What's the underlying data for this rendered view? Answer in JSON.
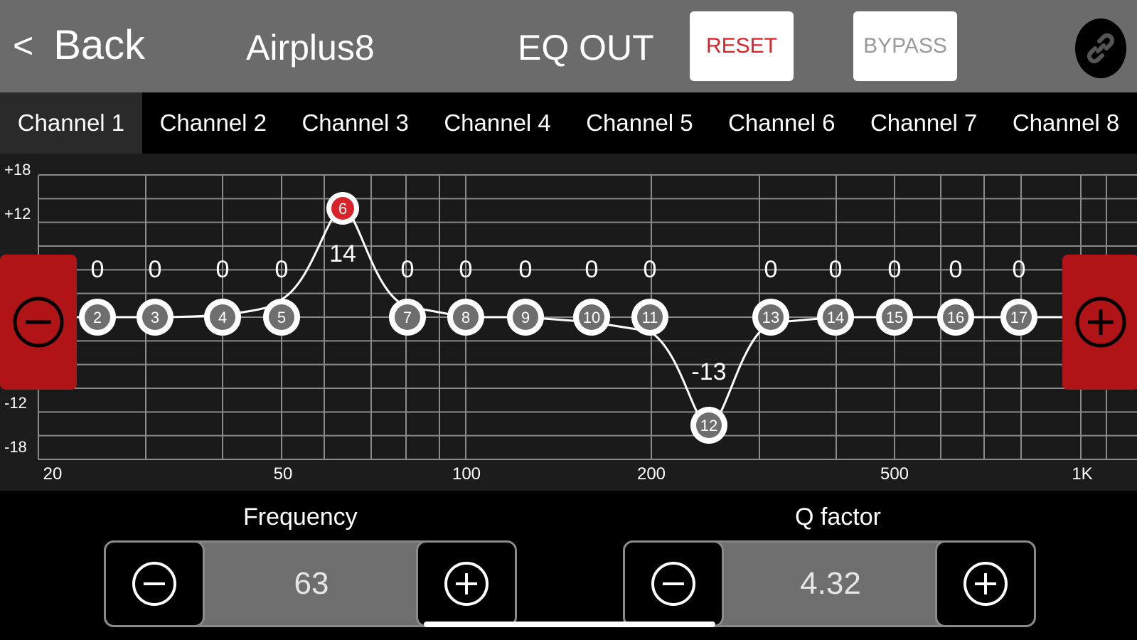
{
  "header": {
    "back_label": "Back",
    "device_name": "Airplus8",
    "title": "EQ OUT",
    "reset_label": "RESET",
    "bypass_label": "BYPASS"
  },
  "tabs": [
    "Channel 1",
    "Channel 2",
    "Channel 3",
    "Channel 4",
    "Channel 5",
    "Channel 6",
    "Channel 7",
    "Channel 8"
  ],
  "active_tab": 0,
  "eq": {
    "y_labels": [
      "+18",
      "+12",
      "-12",
      "-18"
    ],
    "x_labels": [
      "20",
      "50",
      "100",
      "200",
      "500",
      "1K"
    ],
    "bands": [
      {
        "id": "2",
        "gain": "0"
      },
      {
        "id": "3",
        "gain": "0"
      },
      {
        "id": "4",
        "gain": "0"
      },
      {
        "id": "5",
        "gain": "0"
      },
      {
        "id": "6",
        "gain": "14",
        "selected": true
      },
      {
        "id": "7",
        "gain": "0"
      },
      {
        "id": "8",
        "gain": "0"
      },
      {
        "id": "9",
        "gain": "0"
      },
      {
        "id": "10",
        "gain": "0"
      },
      {
        "id": "11",
        "gain": "0"
      },
      {
        "id": "12",
        "gain": "-13"
      },
      {
        "id": "13",
        "gain": "0"
      },
      {
        "id": "14",
        "gain": "0"
      },
      {
        "id": "15",
        "gain": "0"
      },
      {
        "id": "16",
        "gain": "0"
      },
      {
        "id": "17",
        "gain": "0"
      }
    ]
  },
  "frequency": {
    "label": "Frequency",
    "value": "63"
  },
  "q_factor": {
    "label": "Q factor",
    "value": "4.32"
  },
  "colors": {
    "accent": "#b01416",
    "selected_node": "#d8232a",
    "reset_text": "#d8232a"
  }
}
